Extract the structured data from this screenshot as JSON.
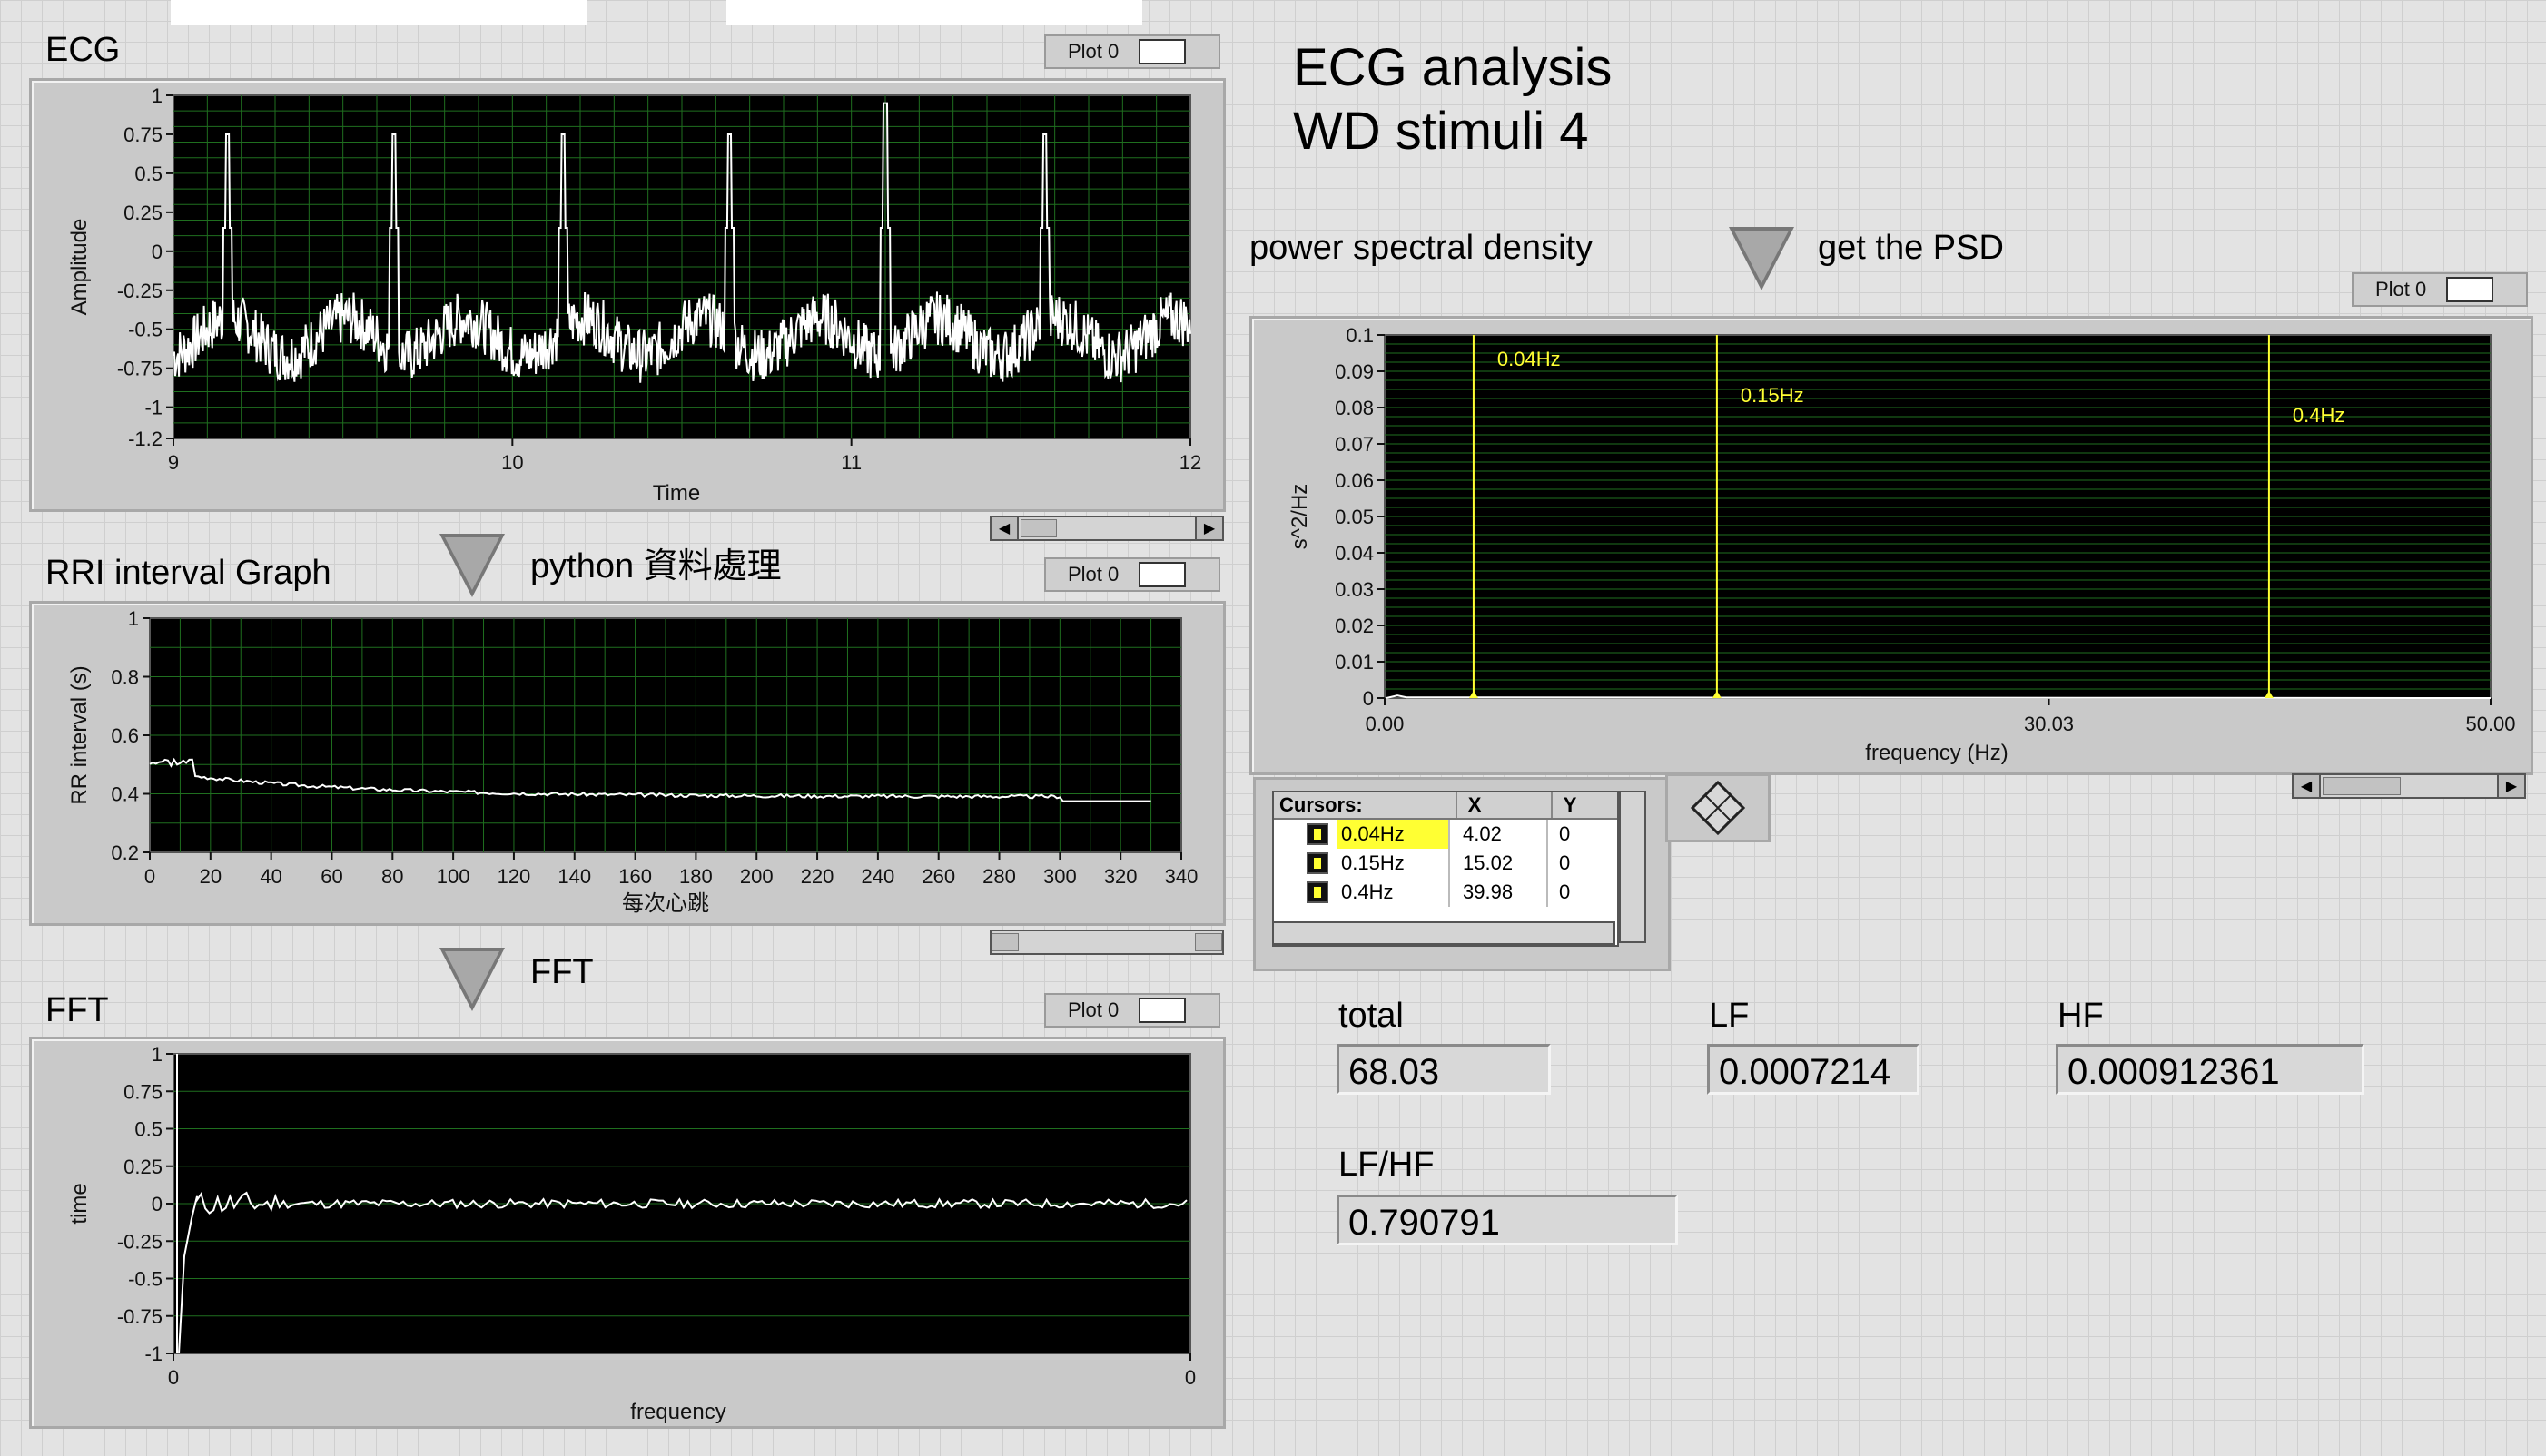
{
  "window": {
    "title": "ECG analysis\nWD stimuli 4",
    "title_line1": "ECG analysis",
    "title_line2": "WD stimuli 4"
  },
  "labels": {
    "ecg": "ECG",
    "rri": "RRI interval Graph",
    "fft": "FFT",
    "python": "python 資料處理",
    "fft_step": "FFT",
    "psd": "power spectral density",
    "get_psd": "get the PSD",
    "plot_btn": "Plot 0"
  },
  "ecg_chart": {
    "type": "line",
    "xlabel": "Time",
    "ylabel": "Amplitude",
    "xlim": [
      9,
      12
    ],
    "ylim": [
      -1.2,
      1
    ],
    "xticks": [
      "9",
      "10",
      "11",
      "12"
    ],
    "yticks": [
      "1",
      "0.75",
      "0.5",
      "0.25",
      "0",
      "-0.25",
      "-0.5",
      "-0.75",
      "-1",
      "-1.2"
    ]
  },
  "rri_chart": {
    "type": "line",
    "xlabel": "每次心跳",
    "ylabel": "RR interval (s)",
    "xlim": [
      0,
      340
    ],
    "ylim": [
      0.2,
      1
    ],
    "xticks": [
      "0",
      "20",
      "40",
      "60",
      "80",
      "100",
      "120",
      "140",
      "160",
      "180",
      "200",
      "220",
      "240",
      "260",
      "280",
      "300",
      "320",
      "340"
    ],
    "yticks": [
      "1",
      "0.8",
      "0.6",
      "0.4",
      "0.2"
    ]
  },
  "fft_chart": {
    "type": "line",
    "xlabel": "frequency",
    "ylabel": "time",
    "ylim": [
      -1,
      1
    ],
    "xticks": [
      "0",
      "0"
    ],
    "yticks": [
      "1",
      "0.75",
      "0.5",
      "0.25",
      "0",
      "-0.25",
      "-0.5",
      "-0.75",
      "-1"
    ]
  },
  "psd_chart": {
    "type": "line",
    "xlabel": "frequency (Hz)",
    "ylabel": "s^2/Hz",
    "xlim": [
      0,
      50
    ],
    "ylim": [
      0,
      0.1
    ],
    "xticks": [
      "0.00",
      "30.03",
      "50.00"
    ],
    "yticks": [
      "0.1",
      "0.09",
      "0.08",
      "0.07",
      "0.06",
      "0.05",
      "0.04",
      "0.03",
      "0.02",
      "0.01",
      "0"
    ],
    "cursors": [
      {
        "name": "0.04Hz",
        "x": 4.02,
        "y": 0
      },
      {
        "name": "0.15Hz",
        "x": 15.02,
        "y": 0
      },
      {
        "name": "0.4Hz",
        "x": 39.98,
        "y": 0
      }
    ]
  },
  "cursor_table": {
    "header": {
      "cursors": "Cursors:",
      "x": "X",
      "y": "Y"
    },
    "rows": [
      {
        "name": "0.04Hz",
        "x": "4.02",
        "y": "0"
      },
      {
        "name": "0.15Hz",
        "x": "15.02",
        "y": "0"
      },
      {
        "name": "0.4Hz",
        "x": "39.98",
        "y": "0"
      }
    ]
  },
  "indicators": {
    "total_label": "total",
    "total_value": "68.03",
    "lf_label": "LF",
    "lf_value": "0.0007214",
    "hf_label": "HF",
    "hf_value": "0.000912361",
    "lfhf_label": "LF/HF",
    "lfhf_value": "0.790791"
  },
  "colors": {
    "plot_bg": "#000000",
    "grid": "#1f7a1f",
    "trace": "#ffffff",
    "cursor": "#ffff33"
  }
}
